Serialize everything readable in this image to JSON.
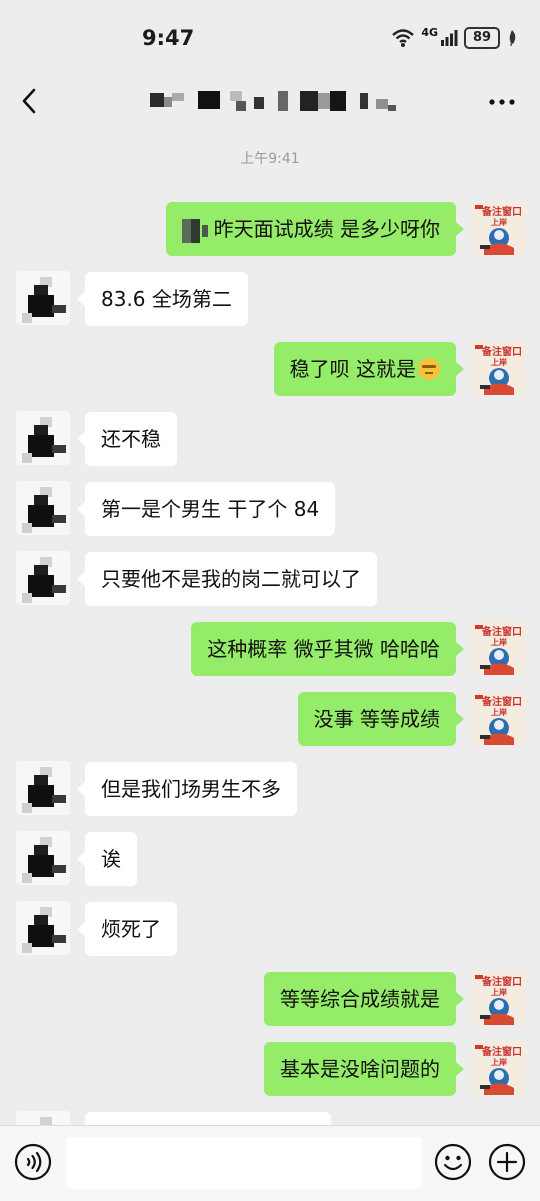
{
  "status_bar": {
    "time": "9:47",
    "network": "4G",
    "battery": "89"
  },
  "header": {
    "title": ""
  },
  "timestamp": "上午9:41",
  "messages": [
    {
      "sender": "me",
      "text": "昨天面试成绩  是多少呀你"
    },
    {
      "sender": "other",
      "text": "83.6 全场第二"
    },
    {
      "sender": "me",
      "text": "稳了呗 这就是"
    },
    {
      "sender": "other",
      "text": "还不稳"
    },
    {
      "sender": "other",
      "text": "第一是个男生 干了个 84"
    },
    {
      "sender": "other",
      "text": "只要他不是我的岗二就可以了"
    },
    {
      "sender": "me",
      "text": "这种概率 微乎其微  哈哈哈"
    },
    {
      "sender": "me",
      "text": "没事 等等成绩"
    },
    {
      "sender": "other",
      "text": "但是我们场男生不多"
    },
    {
      "sender": "other",
      "text": "诶"
    },
    {
      "sender": "other",
      "text": "烦死了"
    },
    {
      "sender": "me",
      "text": "等等综合成绩就是"
    },
    {
      "sender": "me",
      "text": "基本是没啥问题的"
    },
    {
      "sender": "other",
      "text": ""
    }
  ],
  "avatars": {
    "me_badge_text": "备注窗口",
    "me_badge_sub": "上岸"
  },
  "input": {
    "placeholder": "",
    "value": ""
  },
  "icons": {
    "back": "chevron-left-icon",
    "more": "more-dots-icon",
    "voice": "voice-icon",
    "emoji": "emoji-icon",
    "plus": "plus-icon",
    "signal": "signal-icon",
    "wifi": "wifi-icon",
    "battery": "battery-icon",
    "leaf": "leaf-icon",
    "thinking": "thinking-face-emoji"
  },
  "colors": {
    "background": "#ededed",
    "my_bubble": "#95ec69",
    "their_bubble": "#ffffff",
    "input_bar": "#f7f7f7"
  }
}
